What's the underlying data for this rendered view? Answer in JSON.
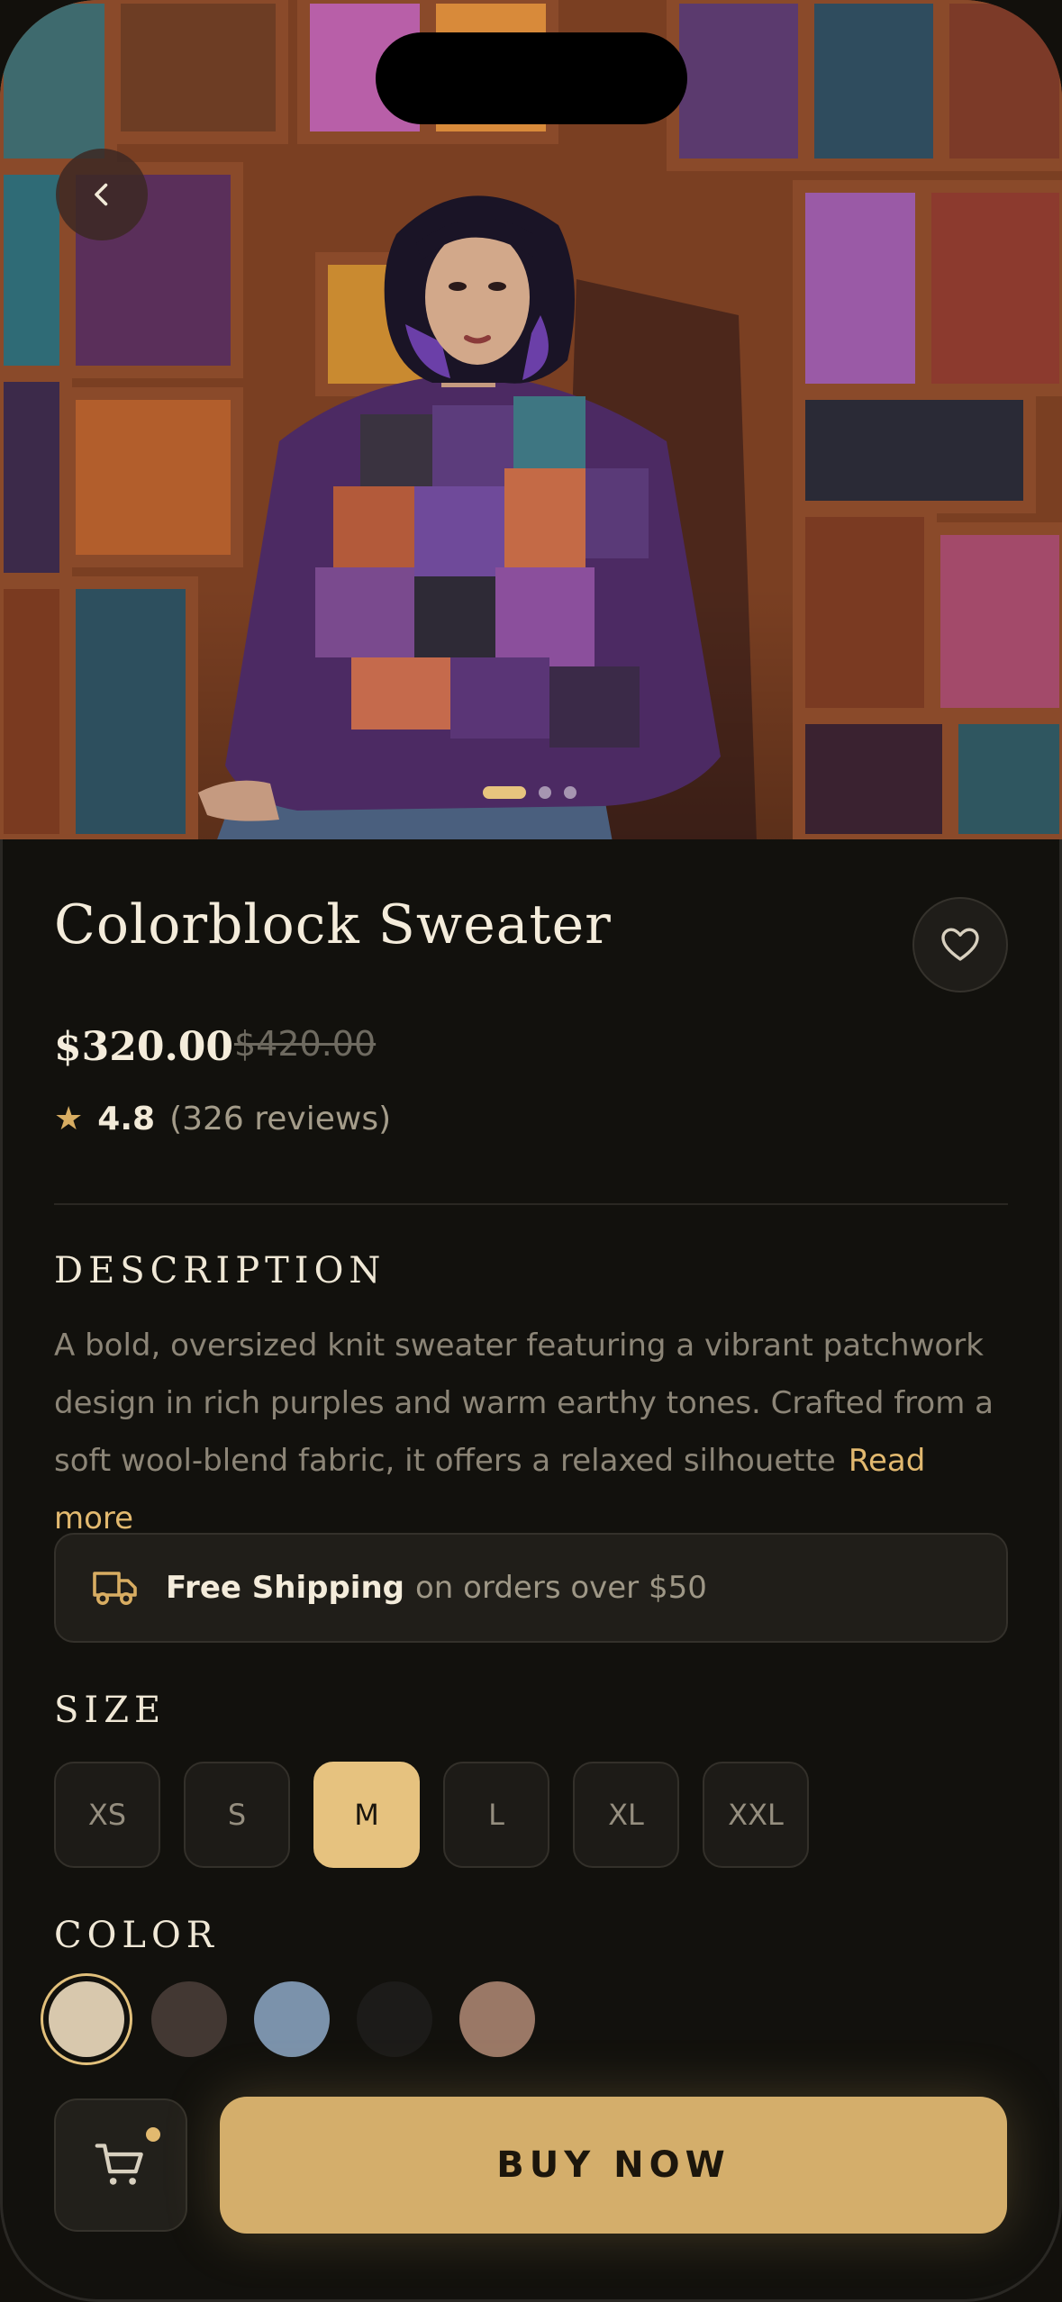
{
  "product": {
    "title": "Colorblock Sweater",
    "price": "$320.00",
    "old_price": "$420.00",
    "rating": "4.8",
    "reviews": "(326 reviews)",
    "image_count": 3,
    "active_image": 1
  },
  "description": {
    "label": "DESCRIPTION",
    "text": "A bold, oversized knit sweater featuring a vibrant patchwork design in rich purples and warm earthy tones. Crafted from a soft wool-blend fabric, it offers a relaxed silhouette",
    "read_more": "Read more"
  },
  "shipping": {
    "strong": "Free Shipping",
    "rest": "on orders over $50",
    "icon": "truck-icon"
  },
  "size": {
    "label": "SIZE",
    "options": [
      "XS",
      "S",
      "M",
      "L",
      "XL",
      "XXL"
    ],
    "selected": "M"
  },
  "color": {
    "label": "COLOR",
    "options": [
      "#d8c8ad",
      "#433833",
      "#7b92ab",
      "#1c1b19",
      "#9a7866"
    ],
    "selected_index": 0
  },
  "actions": {
    "buy_label": "BUY NOW"
  },
  "theme": {
    "accent": "#e6c27f",
    "background": "#12110d"
  }
}
